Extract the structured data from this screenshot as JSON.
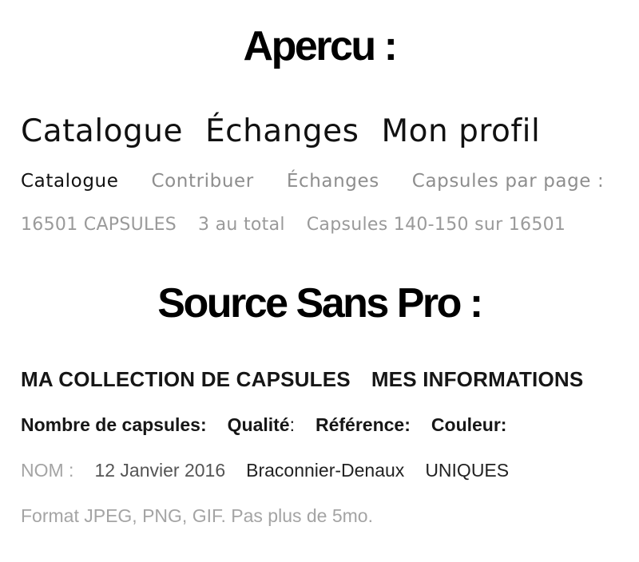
{
  "apercu": {
    "heading": "Apercu :",
    "big_nav": [
      "Catalogue",
      "Échanges",
      "Mon profil"
    ],
    "small_nav": {
      "active": "Catalogue",
      "items": [
        "Contribuer",
        "Échanges",
        "Capsules par page :"
      ]
    },
    "meta": [
      "16501 CAPSULES",
      "3 au total",
      "Capsules 140-150 sur 16501"
    ]
  },
  "source_sans": {
    "heading": "Source Sans Pro :",
    "sections": [
      "MA COLLECTION DE CAPSULES",
      "MES INFORMATIONS"
    ],
    "labels": [
      {
        "text": "Nombre de capsules",
        "colon": " :"
      },
      {
        "text": "Qualité",
        "colon": " :"
      },
      {
        "text": "Référence",
        "colon": " :"
      },
      {
        "text": "Couleur",
        "colon": " :"
      }
    ],
    "values": {
      "nom_label": "NOM :",
      "date": "12 Janvier 2016",
      "name": "Braconnier-Denaux",
      "uniques": "UNIQUES"
    },
    "hint": "Format JPEG, PNG, GIF. Pas plus de 5mo."
  }
}
